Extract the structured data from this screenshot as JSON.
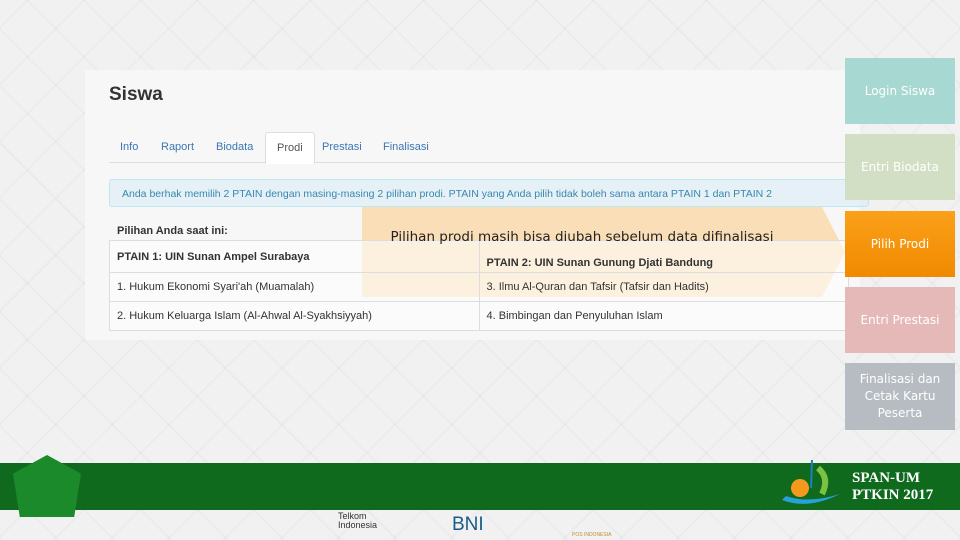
{
  "screenshot": {
    "title": "Siswa",
    "tabs": [
      {
        "label": "Info"
      },
      {
        "label": "Raport"
      },
      {
        "label": "Biodata"
      },
      {
        "label": "Prodi",
        "active": true
      },
      {
        "label": "Prestasi"
      },
      {
        "label": "Finalisasi"
      }
    ],
    "alert": "Anda berhak memilih 2 PTAIN dengan masing-masing 2 pilihan prodi. PTAIN yang Anda pilih tidak boleh sama antara PTAIN 1 dan PTAIN 2",
    "pilihan_label": "Pilihan Anda saat ini:",
    "table": [
      [
        "PTAIN 1: UIN  Sunan Ampel Surabaya",
        "PTAIN 2: UIN  Sunan Gunung Djati Bandung"
      ],
      [
        "1. Hukum Ekonomi Syari'ah (Muamalah)",
        "3. Ilmu Al-Quran dan Tafsir (Tafsir dan Hadits)"
      ],
      [
        "2. Hukum Keluarga Islam (Al-Ahwal Al-Syakhsiyyah)",
        "4. Bimbingan dan Penyuluhan Islam"
      ]
    ]
  },
  "callout": "Pilihan prodi masih bisa diubah sebelum data difinalisasi",
  "steps": [
    {
      "label": "Login Siswa",
      "color": "#a8d8d2"
    },
    {
      "label": "Entri Biodata",
      "color": "#d3dfc4"
    },
    {
      "label": "Pilih Prodi",
      "color": "#f7940f",
      "active": true
    },
    {
      "label": "Entri Prestasi",
      "color": "#e6b9b9"
    },
    {
      "label": "Finalisasi dan Cetak Kartu Peserta",
      "color": "#b7bcc3"
    }
  ],
  "footer": {
    "brand_line1": "SPAN-UM",
    "brand_line2": "PTKIN 2017",
    "sponsors": [
      "Telkom Indonesia",
      "BNI",
      "POS INDONESIA"
    ],
    "band_color": "#0f6a1e"
  }
}
